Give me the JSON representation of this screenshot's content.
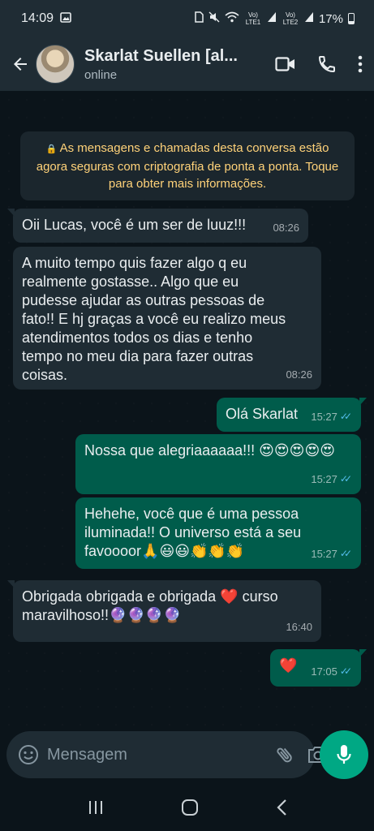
{
  "status_bar": {
    "time": "14:09",
    "lte1": "Vo) LTE1",
    "lte2": "Vo) LTE2",
    "battery": "17%"
  },
  "header": {
    "contact_name": "Skarlat Suellen [al...",
    "status": "online"
  },
  "system_message": "As mensagens e chamadas desta conversa estão agora seguras com criptografia de ponta a ponta. Toque para obter mais informações.",
  "messages": [
    {
      "dir": "in",
      "text": "Oii Lucas, você é um ser de luuz!!!",
      "time": "08:26"
    },
    {
      "dir": "in",
      "text": "A muito tempo quis fazer algo q eu realmente gostasse.. Algo que eu pudesse ajudar as outras pessoas de fato!! E hj graças a você eu realizo meus atendimentos todos os dias e tenho tempo no meu dia para fazer outras coisas.",
      "time": "08:26"
    },
    {
      "dir": "out",
      "text": "Olá Skarlat",
      "time": "15:27"
    },
    {
      "dir": "out",
      "text": "Nossa que alegriaaaaaa!!! 😍😍😍😍😍",
      "time": "15:27"
    },
    {
      "dir": "out",
      "text": "Hehehe, você que é uma pessoa iluminada!! O universo está a seu favoooor🙏😃😃👏👏👏",
      "time": "15:27"
    },
    {
      "dir": "in",
      "text": "Obrigada obrigada e obrigada ❤️ curso maravilhoso!!🔮🔮🔮🔮",
      "time": "16:40"
    },
    {
      "dir": "out",
      "text": "❤️",
      "time": "17:05"
    }
  ],
  "input": {
    "placeholder": "Mensagem"
  },
  "colors": {
    "incoming_bubble": "#1f2c34",
    "outgoing_bubble": "#005c4b",
    "accent": "#00a884",
    "read_ticks": "#53bdeb",
    "system_text": "#ffd279"
  }
}
